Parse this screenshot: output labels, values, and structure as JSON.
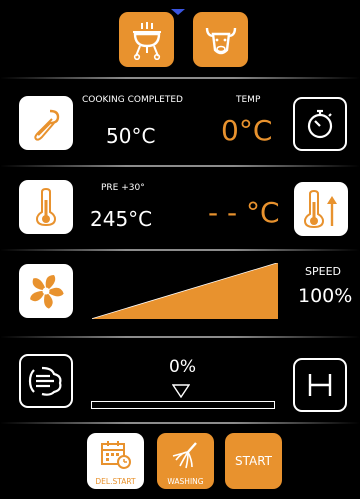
{
  "colors": {
    "accent": "#E8922E",
    "background": "#000000",
    "text": "#FFFFFF"
  },
  "top_modes": [
    {
      "name": "grill",
      "icon": "grill-icon"
    },
    {
      "name": "meat",
      "icon": "bull-head-icon"
    }
  ],
  "probe_row": {
    "status_label": "COOKING COMPLETED",
    "probe_value": "50°C",
    "temp_label": "TEMP",
    "temp_value": "0°C"
  },
  "preheat_row": {
    "pre_label": "PRE +30°",
    "set_value": "245°C",
    "current_value": "- - °C"
  },
  "fan_row": {
    "speed_label": "SPEED",
    "speed_value": "100%",
    "speed_level": 1.0
  },
  "humidity_row": {
    "value": "0%",
    "level": 0.0
  },
  "bottom_buttons": {
    "delayed_start": "DEL.START",
    "washing": "WASHING",
    "start": "START"
  }
}
